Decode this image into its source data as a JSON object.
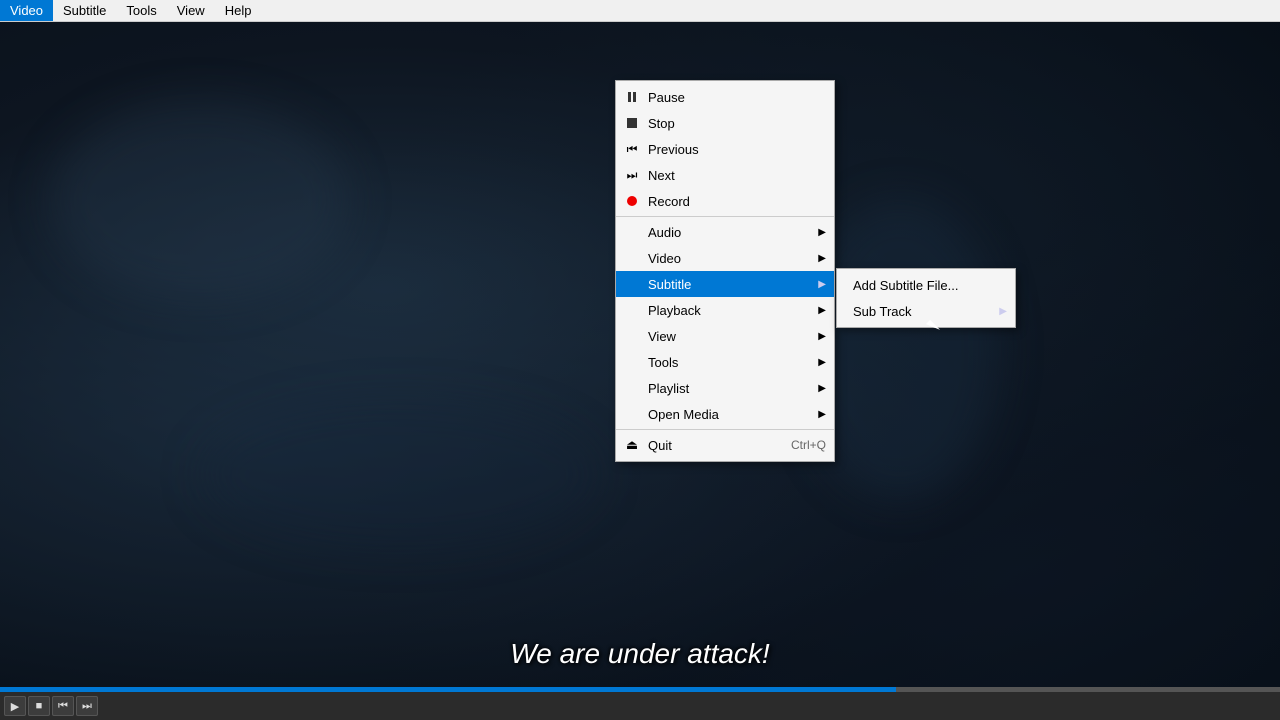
{
  "menubar": {
    "items": [
      "Video",
      "Subtitle",
      "Tools",
      "View",
      "Help"
    ]
  },
  "context_menu": {
    "items": [
      {
        "id": "pause",
        "label": "Pause",
        "icon_type": "pause",
        "shortcut": ""
      },
      {
        "id": "stop",
        "label": "Stop",
        "icon_type": "stop",
        "shortcut": ""
      },
      {
        "id": "previous",
        "label": "Previous",
        "icon_type": "skip-prev",
        "shortcut": ""
      },
      {
        "id": "next",
        "label": "Next",
        "icon_type": "skip-next",
        "shortcut": ""
      },
      {
        "id": "record",
        "label": "Record",
        "icon_type": "record",
        "shortcut": ""
      },
      {
        "id": "audio",
        "label": "Audio",
        "icon_type": "none",
        "shortcut": "",
        "has_arrow": true
      },
      {
        "id": "video",
        "label": "Video",
        "icon_type": "none",
        "shortcut": "",
        "has_arrow": true
      },
      {
        "id": "subtitle",
        "label": "Subtitle",
        "icon_type": "none",
        "shortcut": "",
        "has_arrow": true,
        "active": true
      },
      {
        "id": "playback",
        "label": "Playback",
        "icon_type": "none",
        "shortcut": "",
        "has_arrow": true
      },
      {
        "id": "view",
        "label": "View",
        "icon_type": "none",
        "shortcut": "",
        "has_arrow": true
      },
      {
        "id": "tools",
        "label": "Tools",
        "icon_type": "none",
        "shortcut": "",
        "has_arrow": true
      },
      {
        "id": "playlist",
        "label": "Playlist",
        "icon_type": "none",
        "shortcut": "",
        "has_arrow": true
      },
      {
        "id": "open-media",
        "label": "Open Media",
        "icon_type": "none",
        "shortcut": "",
        "has_arrow": true
      },
      {
        "id": "quit",
        "label": "Quit",
        "icon_type": "quit",
        "shortcut": "Ctrl+Q"
      }
    ]
  },
  "subtitle_submenu": {
    "items": [
      {
        "id": "add-subtitle-file",
        "label": "Add Subtitle File...",
        "shortcut": ""
      },
      {
        "id": "sub-track",
        "label": "Sub Track",
        "shortcut": "",
        "has_arrow": true
      }
    ]
  },
  "subtitle": {
    "text": "We are under attack!"
  },
  "progress": {
    "fill_percent": 70
  }
}
